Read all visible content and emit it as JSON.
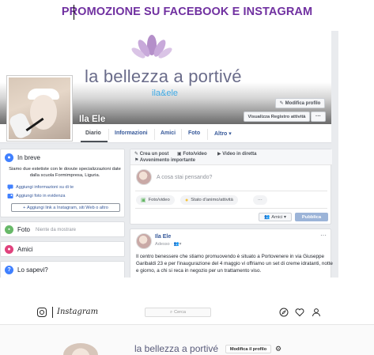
{
  "slide": {
    "title": "PROMOZIONE SU FACEBOOK E INSTAGRAM"
  },
  "facebook": {
    "cover": {
      "brand": "la bellezza a portivé",
      "subbrand": "ila&ele"
    },
    "page_name": "Ila Ele",
    "buttons": {
      "edit_profile": "Modifica profilo",
      "activity_log": "Visualizza Registro attività",
      "more": "···"
    },
    "tabs": [
      {
        "label": "Diario"
      },
      {
        "label": "Informazioni"
      },
      {
        "label": "Amici"
      },
      {
        "label": "Foto"
      },
      {
        "label": "Altro ▾"
      }
    ],
    "intro": {
      "title": "In breve",
      "description": "Siamo due estetiste con le dovute specializzazioni date dalla scuola Formimpresa, Liguria.",
      "links": [
        "Aggiungi informazioni su di te",
        "Aggiungi foto in evidenza"
      ],
      "add_links": "Aggiungi link a Instagram, siti Web o altro"
    },
    "photos": {
      "title": "Foto",
      "empty": "Niente da mostrare"
    },
    "friends": {
      "title": "Amici"
    },
    "did_you_know": {
      "title": "Lo sapevi?"
    },
    "composer": {
      "create_post": "Crea un post",
      "photo_video": "Foto/video",
      "live": "Video in diretta",
      "life_event": "Avvenimento importante",
      "placeholder": "A cosa stai pensando?",
      "chip_photo": "Foto/video",
      "chip_mood": "Stato d'animo/attività",
      "audience": "Amici ▾",
      "publish": "Pubblica"
    },
    "post": {
      "author": "Ila Ele",
      "time": "Adesso · ",
      "more": "···",
      "text": "Il centro benessere che stiamo promuovendo è situato a Portovenere in via Giuseppe Garibaldi 23 e per l'inaugurazione del 4 maggio vi offriamo un set di creme idratanti, notte e giorno, a chi si reca in negozio per un trattamento viso."
    }
  },
  "instagram": {
    "wordmark": "Instagram",
    "search_placeholder": "Cerca",
    "brand": "la bellezza a portivé",
    "edit_profile": "Modifica il profilo"
  },
  "colors": {
    "title_purple": "#7030a0",
    "fb_link": "#365899",
    "fb_bg": "#e9ebee",
    "publish_disabled": "#9cb4d8"
  }
}
